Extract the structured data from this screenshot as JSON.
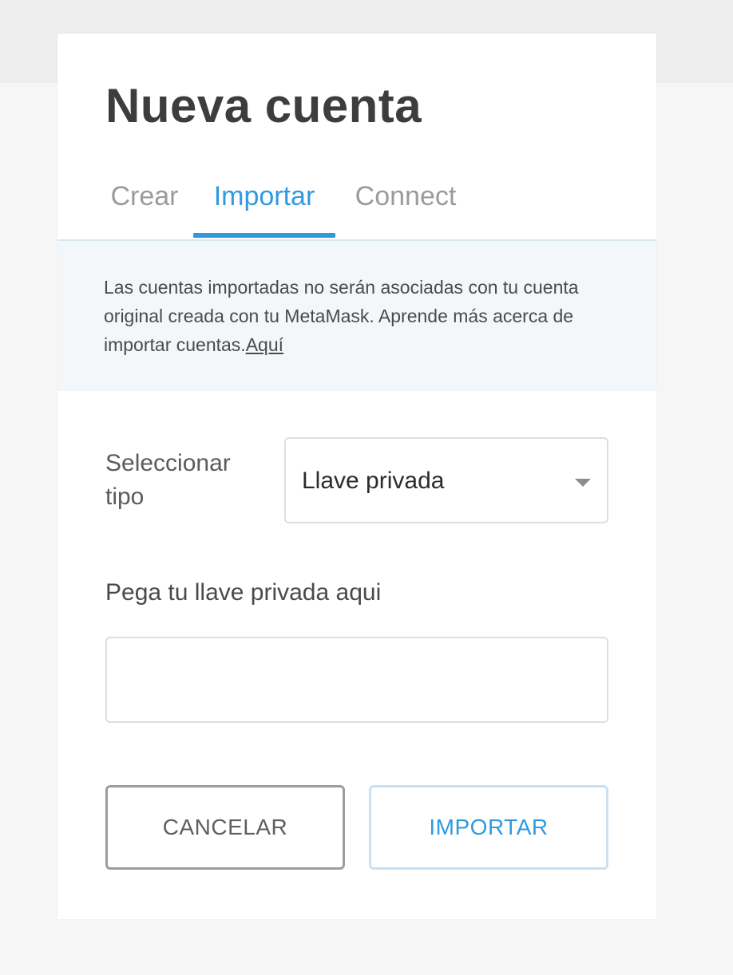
{
  "page": {
    "title": "Nueva cuenta"
  },
  "tabs": [
    {
      "label": "Crear",
      "active": false
    },
    {
      "label": "Importar",
      "active": true
    },
    {
      "label": "Connect",
      "active": false
    }
  ],
  "notice": {
    "text": "Las cuentas importadas no serán asociadas con tu cuenta original creada con tu MetaMask. Aprende más acerca de importar cuentas.",
    "link_label": "Aquí"
  },
  "form": {
    "type_label": "Seleccionar tipo",
    "type_selected": "Llave privada",
    "key_label": "Pega tu llave privada aqui",
    "key_value": "",
    "key_placeholder": ""
  },
  "buttons": {
    "cancel_label": "CANCELAR",
    "import_label": "IMPORTAR"
  },
  "colors": {
    "accent": "#2f9ae0",
    "notice_bg": "#f3f7f9",
    "title": "#3d3d3d"
  },
  "icons": {
    "select_caret": "caret-down-icon"
  }
}
